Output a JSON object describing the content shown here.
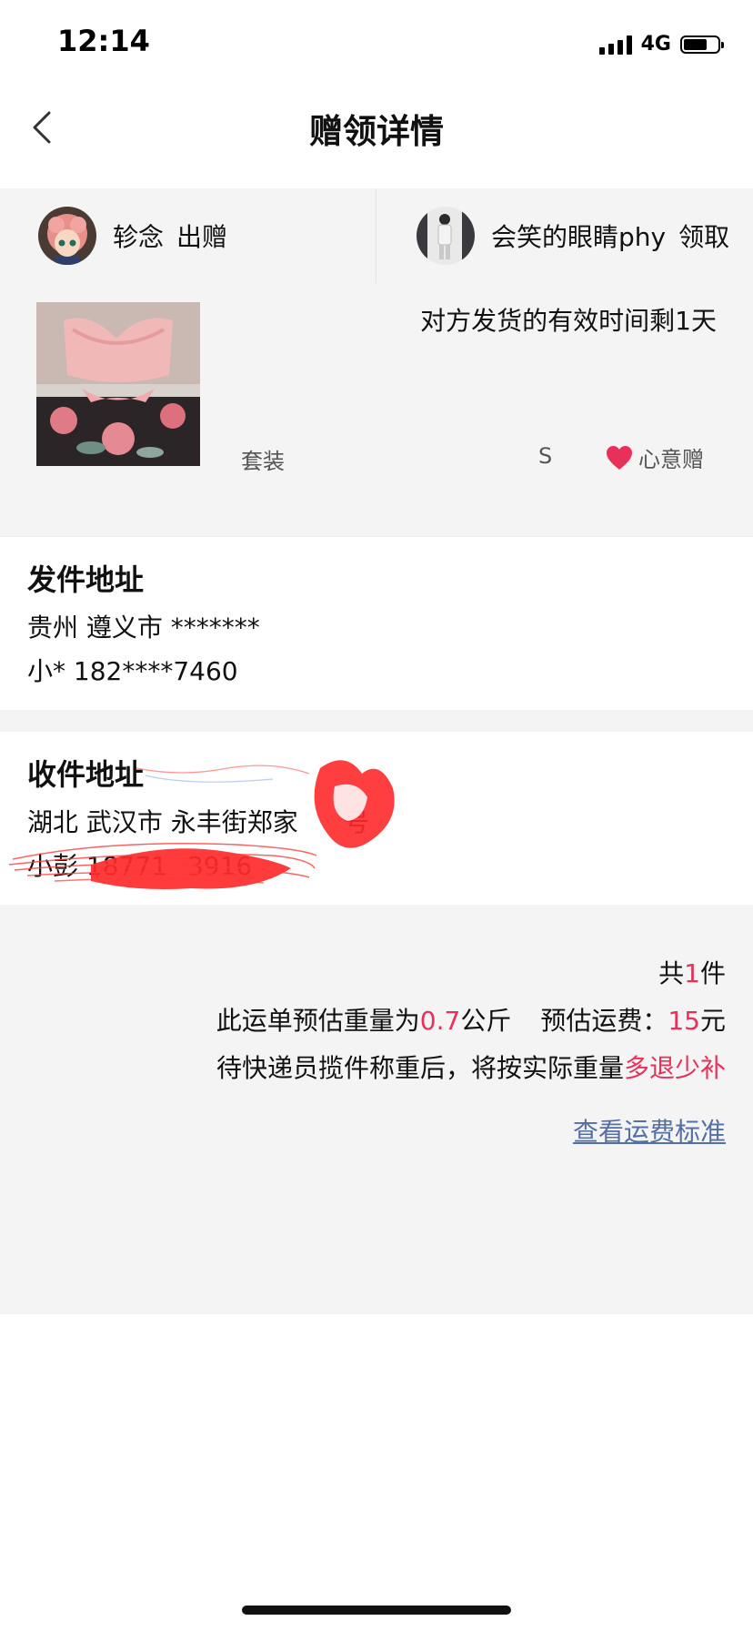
{
  "status_bar": {
    "time": "12:14",
    "network": "4G",
    "battery_level": 0.7
  },
  "nav": {
    "title": "赠领详情",
    "back_icon": "chevron-left-icon"
  },
  "parties": {
    "giver": {
      "name": "轸念",
      "role": "出赠"
    },
    "receiver": {
      "name": "会笑的眼睛phy",
      "role": "领取"
    }
  },
  "item": {
    "deadline_text": "对方发货的有效时间剩1天",
    "name": "套装",
    "size": "S",
    "gift_type": "心意赠",
    "gift_icon": "heart-icon"
  },
  "sender_address": {
    "title": "发件地址",
    "line1": "贵州 遵义市 *******",
    "line2": "小* 182****7460"
  },
  "receiver_address": {
    "title": "收件地址",
    "line1": "湖北 武汉市 永丰街郑家",
    "line1_suffix": "号",
    "line2": "小彭 18771",
    "line2_suffix": "3916"
  },
  "freight": {
    "count_prefix": "共",
    "count": "1",
    "count_suffix": "件",
    "weight_prefix": "此运单预估重量为",
    "weight": "0.7",
    "weight_unit": "公斤",
    "fee_label": "预估运费：",
    "fee": "15",
    "fee_unit": "元",
    "note_prefix": "待快递员揽件称重后，将按实际重量",
    "note_highlight": "多退少补",
    "link_text": "查看运费标准"
  },
  "colors": {
    "accent": "#e8305a",
    "link": "#536fa6",
    "panel_bg": "#f4f4f4",
    "redaction": "#ff2a2a"
  }
}
